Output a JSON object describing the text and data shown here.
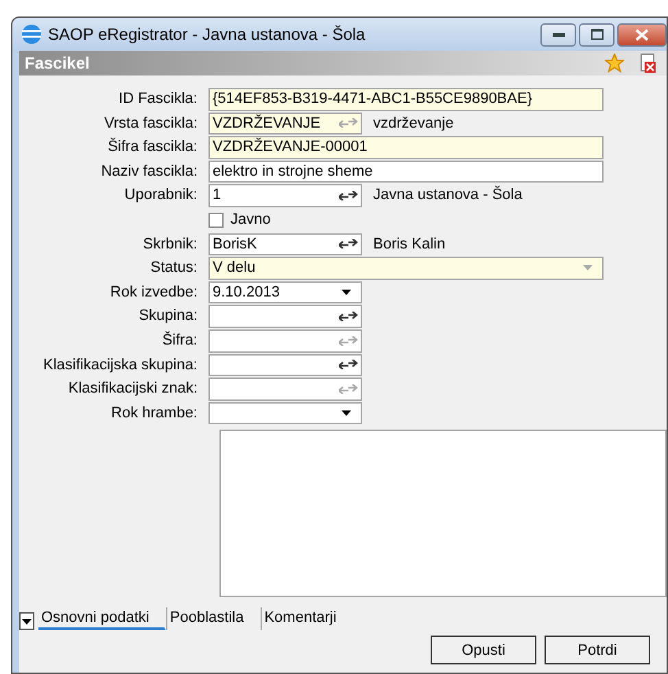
{
  "window": {
    "title": "SAOP eRegistrator - Javna ustanova - Šola"
  },
  "panel": {
    "title": "Fascikel"
  },
  "fields": [
    {
      "label": "ID Fascikla:",
      "kind": "text",
      "value": "{514EF853-B319-4471-ABC1-B55CE9890BAE}",
      "required": true
    },
    {
      "label": "Vrsta fascikla:",
      "kind": "lookup",
      "value": "VZDRŽEVANJE",
      "required": true,
      "disabled": true,
      "description": "vzdrževanje"
    },
    {
      "label": "Šifra fascikla:",
      "kind": "text",
      "value": "VZDRŽEVANJE-00001",
      "required": true
    },
    {
      "label": "Naziv fascikla:",
      "kind": "text",
      "value": "elektro in strojne sheme",
      "required": false
    },
    {
      "label": "Uporabnik:",
      "kind": "lookup",
      "value": "1",
      "required": false,
      "disabled": false,
      "description": "Javna ustanova - Šola"
    },
    {
      "label": "Javno",
      "kind": "checkbox",
      "checked": false
    },
    {
      "label": "Skrbnik:",
      "kind": "lookup",
      "value": "BorisK",
      "required": false,
      "disabled": false,
      "description": "Boris Kalin"
    },
    {
      "label": "Status:",
      "kind": "select",
      "value": "V delu",
      "required": true,
      "disabled": true
    },
    {
      "label": "Rok izvedbe:",
      "kind": "dropdown",
      "value": "9.10.2013"
    },
    {
      "label": "Skupina:",
      "kind": "lookup",
      "required": false,
      "disabled": false
    },
    {
      "label": "Šifra:",
      "kind": "lookup",
      "required": false,
      "disabled": true
    },
    {
      "label": "Klasifikacijska skupina:",
      "kind": "lookup",
      "required": false,
      "disabled": false
    },
    {
      "label": "Klasifikacijski znak:",
      "kind": "lookup",
      "required": false,
      "disabled": true
    },
    {
      "label": "Rok hrambe:",
      "kind": "dropdown"
    }
  ],
  "tabs": [
    {
      "label": "Osnovni podatki",
      "selected": true
    },
    {
      "label": "Pooblastila",
      "selected": false
    },
    {
      "label": "Komentarji",
      "selected": false
    }
  ],
  "buttons": [
    "Opusti",
    "Potrdi"
  ]
}
